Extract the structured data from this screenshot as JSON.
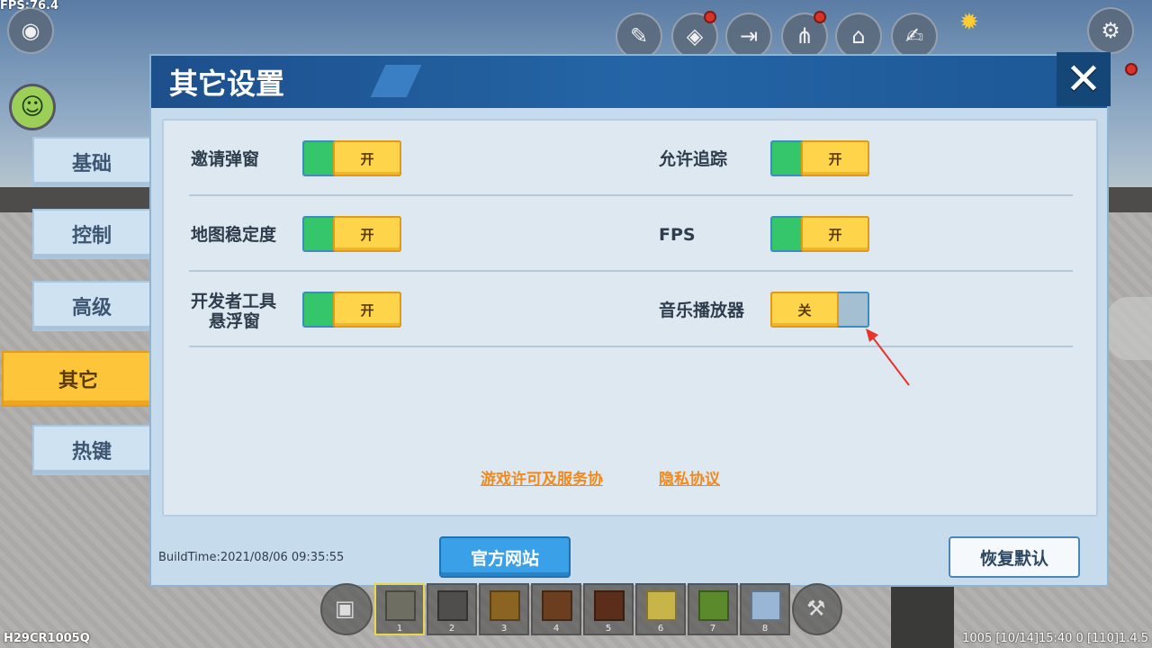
{
  "hud": {
    "fps": "FPS:76.4",
    "bottom_left": "H29CR1005Q",
    "bottom_right": "1005   [10/14]15:40 0   [110]1.4.5"
  },
  "tabs": [
    {
      "label": "基础",
      "active": false
    },
    {
      "label": "控制",
      "active": false
    },
    {
      "label": "高级",
      "active": false
    },
    {
      "label": "其它",
      "active": true
    },
    {
      "label": "热键",
      "active": false
    }
  ],
  "panel": {
    "title": "其它设置",
    "close": "✕"
  },
  "settings": {
    "invite_popup": {
      "label": "邀请弹窗",
      "state": "开"
    },
    "allow_tracking": {
      "label": "允许追踪",
      "state": "开"
    },
    "map_stability": {
      "label": "地图稳定度",
      "state": "开"
    },
    "fps": {
      "label": "FPS",
      "state": "开"
    },
    "dev_tools_line1": "开发者工具",
    "dev_tools_line2": "悬浮窗",
    "dev_tools_state": "开",
    "music_player": {
      "label": "音乐播放器",
      "state": "关"
    }
  },
  "links": {
    "license": "游戏许可及服务协",
    "privacy": "隐私协议"
  },
  "footer": {
    "build_time": "BuildTime:2021/08/06 09:35:55",
    "official_site": "官方网站",
    "restore_default": "恢复默认"
  },
  "hotbar": {
    "slots": [
      "1",
      "2",
      "3",
      "4",
      "5",
      "6",
      "7",
      "8"
    ],
    "colors": [
      "#6f6e63",
      "#4f4e4d",
      "#8a6420",
      "#6a3e1f",
      "#5a2e1a",
      "#c9b44a",
      "#5b8a2c",
      "#9ab6d6"
    ]
  }
}
